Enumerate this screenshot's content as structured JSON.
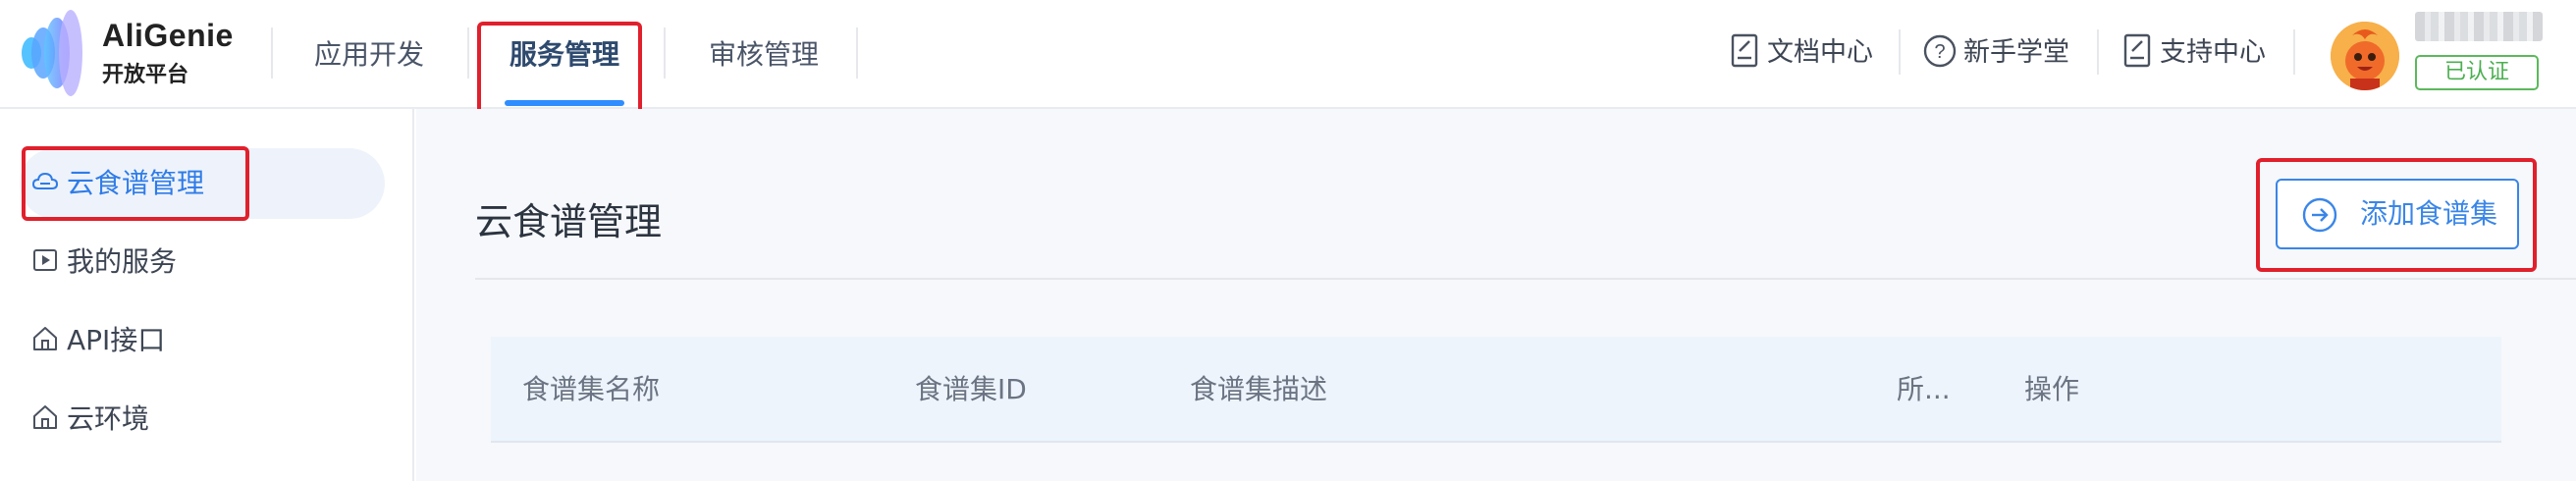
{
  "brand": {
    "name": "AliGenie",
    "subtitle": "开放平台"
  },
  "nav": {
    "tabs": [
      {
        "label": "应用开发"
      },
      {
        "label": "服务管理",
        "active": true
      },
      {
        "label": "审核管理"
      }
    ]
  },
  "utilities": [
    {
      "label": "文档中心",
      "icon": "document-icon"
    },
    {
      "label": "新手学堂",
      "icon": "help-circle-icon"
    },
    {
      "label": "支持中心",
      "icon": "support-doc-icon"
    }
  ],
  "user": {
    "verified_label": "已认证"
  },
  "sidebar": {
    "items": [
      {
        "label": "云食谱管理",
        "icon": "cloud-icon",
        "active": true
      },
      {
        "label": "我的服务",
        "icon": "play-square-icon"
      },
      {
        "label": "API接口",
        "icon": "home-icon"
      },
      {
        "label": "云环境",
        "icon": "home-icon"
      }
    ]
  },
  "main": {
    "title": "云食谱管理",
    "add_button_label": "添加食谱集",
    "table": {
      "columns": [
        "食谱集名称",
        "食谱集ID",
        "食谱集描述",
        "所...",
        "操作"
      ]
    }
  },
  "colors": {
    "accent": "#2f8dff",
    "highlight_red": "#e0202c",
    "verified_green": "#4caf50",
    "active_bg": "#eef3fb"
  }
}
